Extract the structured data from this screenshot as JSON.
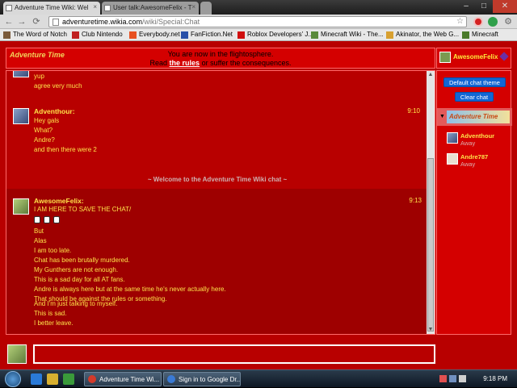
{
  "browser": {
    "tabs": [
      {
        "label": "Adventure Time Wiki: Wel",
        "active": true
      },
      {
        "label": "User talk:AwesomeFelix - T",
        "active": false
      }
    ],
    "url_domain": "adventuretime.wikia.com",
    "url_path": "/wiki/Special:Chat",
    "bookmarks": [
      "The Word of Notch",
      "Club Nintendo",
      "Everybody.net",
      "FanFiction.Net",
      "Roblox Developers' J...",
      "Minecraft Wiki - The...",
      "Akinator, the Web G...",
      "Minecraft"
    ]
  },
  "header": {
    "logo_text": "Adventure Time",
    "line1": "You are now in the flightosphere.",
    "line2_pre": "Read ",
    "rules_link": "the rules",
    "line2_post": " or suffer the consequences."
  },
  "current_user": {
    "name": "AwesomeFelix"
  },
  "messages": {
    "top_partial": [
      "yup",
      "agree very much"
    ],
    "adventhour": {
      "user": "Adventhour:",
      "time": "9:10",
      "lines": [
        "Hey gals",
        "What?",
        "Andre?",
        "and then there were 2"
      ]
    },
    "welcome": "~ Welcome to the Adventure Time Wiki chat ~",
    "awesomefelix": {
      "user": "AwesomeFelix:",
      "time": "9:13",
      "lines": [
        "I AM HERE TO SAVE THE CHAT/",
        "But",
        "Alas",
        "I am too late.",
        "Chat has been brutally murdered.",
        "My Gunthers are not enough.",
        "This is a sad day for all AT fans.",
        "Andre is always here but at the same time he's never actually here.",
        "That should be against the rules or something.",
        "And I'm just talking to myself.",
        "This is sad.",
        "I better leave."
      ]
    }
  },
  "sidebar": {
    "default_theme_btn": "Default chat theme",
    "clear_chat_btn": "Clear chat",
    "room_logo": "Adventure Time",
    "users": [
      {
        "name": "Adventhour",
        "status": "Away"
      },
      {
        "name": "Andre787",
        "status": "Away"
      }
    ]
  },
  "taskbar": {
    "tasks": [
      "Adventure Time Wi...",
      "Sign in to Google Dr..."
    ],
    "clock": "9:18 PM"
  }
}
